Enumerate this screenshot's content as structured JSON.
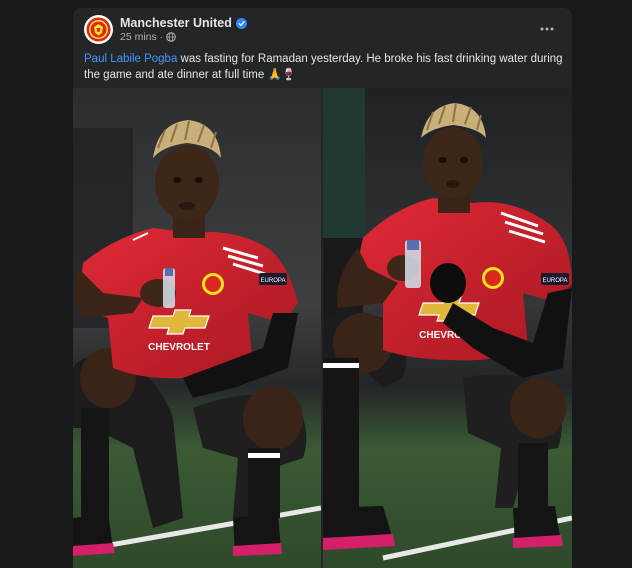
{
  "post": {
    "page_name": "Manchester United",
    "verified_icon": "verified-badge-icon",
    "timestamp": "25 mins",
    "separator": "·",
    "audience_icon": "globe-icon",
    "more_icon": "more-options-icon",
    "caption": {
      "mention": "Paul Labile Pogba",
      "text": " was fasting for Ramadan yesterday. He broke his fast drinking water during the game and ate dinner at full time ",
      "emojis": "🙏🍷"
    },
    "photos": [
      {
        "shirt_sponsor": "CHEVROLET",
        "sleeve_badge": "EUROPA"
      },
      {
        "shirt_sponsor": "CHEVROLET",
        "sleeve_badge": "EUROPA"
      }
    ]
  },
  "colors": {
    "background": "#18191a",
    "card": "#242526",
    "primary_text": "#e4e6eb",
    "secondary_text": "#b0b3b8",
    "link": "#4599ff",
    "verified": "#2d88ff",
    "kit_red": "#d01e2d",
    "pitch_green": "#3d5a2e"
  }
}
